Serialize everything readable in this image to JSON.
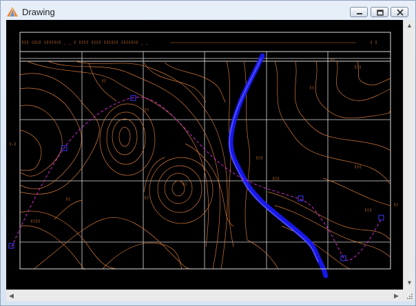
{
  "window": {
    "title": "Drawing",
    "icon": "drawing-app-icon",
    "buttons": {
      "minimize": "minimize-icon",
      "restore": "restore-icon",
      "close": "close-icon"
    }
  },
  "colors": {
    "canvas_background": "#000000",
    "contour": "#d4783a",
    "grid": "#dcdcdc",
    "river": "#1a1aff",
    "route": "#d22ad2",
    "route_vertex": "#3a3aff",
    "chrome": "#dbe5f2"
  },
  "scrollbars": {
    "vertical": {
      "up": "arrow-up-icon",
      "down": "arrow-down-icon"
    },
    "horizontal": {
      "left": "arrow-left-icon",
      "right": "arrow-right-icon"
    }
  }
}
